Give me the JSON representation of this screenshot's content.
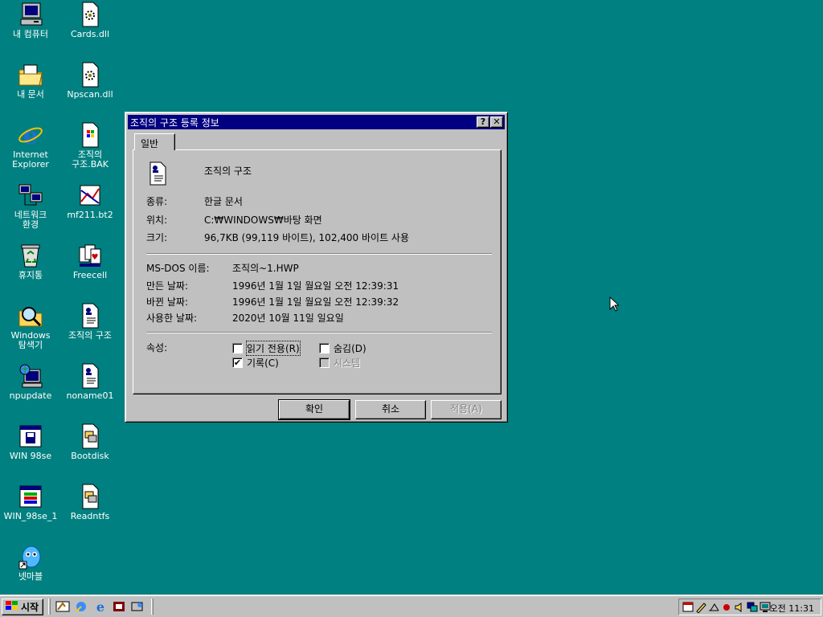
{
  "desktop": {
    "icons": [
      {
        "label": "내 컴퓨터",
        "icon": "my-computer-icon"
      },
      {
        "label": "Cards.dll",
        "icon": "dll-file-icon"
      },
      {
        "label": "내 문서",
        "icon": "my-documents-icon"
      },
      {
        "label": "Npscan.dll",
        "icon": "dll-file-icon"
      },
      {
        "label": "Internet\nExplorer",
        "icon": "internet-explorer-icon"
      },
      {
        "label": "조직의\n구조.BAK",
        "icon": "bak-file-icon"
      },
      {
        "label": "네트워크\n환경",
        "icon": "network-neighborhood-icon"
      },
      {
        "label": "mf211.bt2",
        "icon": "bt2-file-icon"
      },
      {
        "label": "휴지통",
        "icon": "recycle-bin-icon"
      },
      {
        "label": "Freecell",
        "icon": "freecell-icon"
      },
      {
        "label": "Windows\n탐색기",
        "icon": "windows-explorer-icon"
      },
      {
        "label": "조직의 구조",
        "icon": "hwp-document-icon"
      },
      {
        "label": "npupdate",
        "icon": "npupdate-icon"
      },
      {
        "label": "noname01",
        "icon": "hwp-document-icon"
      },
      {
        "label": "WIN 98se",
        "icon": "floppy-window-icon"
      },
      {
        "label": "Bootdisk",
        "icon": "bootdisk-icon"
      },
      {
        "label": "WIN_98se_1",
        "icon": "installer-window-icon"
      },
      {
        "label": "Readntfs",
        "icon": "readntfs-icon"
      },
      {
        "label": "넷마블",
        "icon": "netmarble-icon"
      }
    ]
  },
  "dialog": {
    "title": "조직의 구조 등록 정보",
    "help_button": "?",
    "close_button": "✕",
    "tab": "일반",
    "file_name": "조직의 구조",
    "type_label": "종류:",
    "type_value": "한글 문서",
    "location_label": "위치:",
    "location_value": "C:₩WINDOWS₩바탕 화면",
    "size_label": "크기:",
    "size_value": "96,7KB (99,119 바이트), 102,400 바이트 사용",
    "msdos_label": "MS-DOS 이름:",
    "msdos_value": "조직의~1.HWP",
    "created_label": "만든 날짜:",
    "created_value": "1996년 1월 1일 월요일 오전 12:39:31",
    "modified_label": "바뀐 날짜:",
    "modified_value": "1996년 1월 1일 월요일 오전 12:39:32",
    "accessed_label": "사용한 날짜:",
    "accessed_value": "2020년 10월 11일 일요일",
    "attributes_label": "속성:",
    "attributes": {
      "readonly": {
        "label": "읽기 전용(R)",
        "checked": false
      },
      "hidden": {
        "label": "숨김(D)",
        "checked": false
      },
      "archive": {
        "label": "기록(C)",
        "checked": true
      },
      "system": {
        "label": "시스템",
        "checked": false,
        "disabled": true
      }
    },
    "buttons": {
      "ok": "확인",
      "cancel": "취소",
      "apply": "적용(A)"
    }
  },
  "taskbar": {
    "start_label": "시작",
    "clock": "오전 11:31",
    "quick_launch": [
      "show-desktop-icon",
      "outlook-express-icon",
      "internet-explorer-icon",
      "channel-icon",
      "view-channels-icon"
    ],
    "tray": [
      "scheduler-icon",
      "pen-icon",
      "scanner-icon",
      "antivirus-icon",
      "volume-icon",
      "network-icon",
      "display-icon"
    ]
  }
}
